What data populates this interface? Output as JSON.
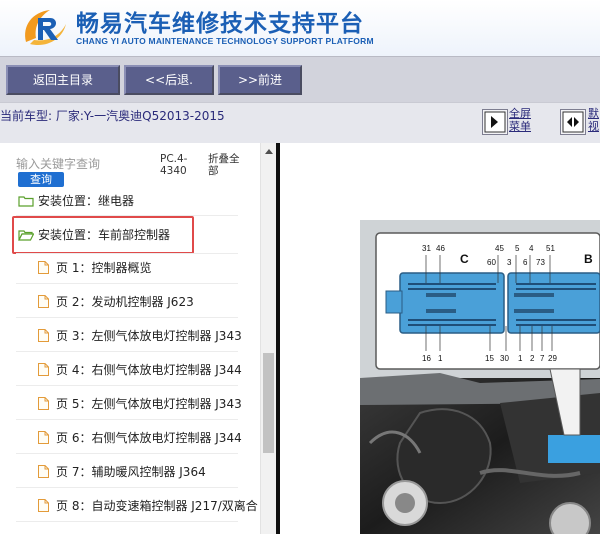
{
  "header": {
    "title": "畅易汽车维修技术支持平台",
    "subtitle": "CHANG YI AUTO MAINTENANCE TECHNOLOGY SUPPORT PLATFORM",
    "brand_color": "#1b5fb5"
  },
  "toolbar": {
    "home_label": "返回主目录",
    "back_label": "<<后退.",
    "forward_label": ">>前进"
  },
  "vehicle_bar": {
    "text": "当前车型:  厂家:Y-一汽奥迪Q52013-2015",
    "fullscreen_label_1": "全屏",
    "fullscreen_label_2": "菜单",
    "default_label_1": "默",
    "default_label_2": "视"
  },
  "search": {
    "placeholder": "输入关键字查询",
    "query_label": "查询",
    "pc_label": "PC.4-4340",
    "fold_label": "折叠全部"
  },
  "tree": {
    "folders": [
      {
        "label": "安装位置：继电器"
      },
      {
        "label": "安装位置：车前部控制器"
      }
    ],
    "pages": [
      {
        "label": "页 1：控制器概览"
      },
      {
        "label": "页 2：发动机控制器 J623"
      },
      {
        "label": "页 3：左侧气体放电灯控制器 J343"
      },
      {
        "label": "页 4：右侧气体放电灯控制器 J344"
      },
      {
        "label": "页 5：左侧气体放电灯控制器 J343"
      },
      {
        "label": "页 6：右侧气体放电灯控制器 J344"
      },
      {
        "label": "页 7：辅助暖风控制器 J364"
      },
      {
        "label": "页 8：自动变速箱控制器 J217/双离合"
      }
    ]
  },
  "diagram": {
    "label_c": "C",
    "label_b": "B",
    "top_pins_left": [
      "31",
      "46"
    ],
    "top_pins_mid": [
      "45",
      "5",
      "4",
      "51"
    ],
    "top_pins_row2": [
      "60",
      "3",
      "6",
      "73"
    ],
    "bottom_pins_left": [
      "16",
      "1"
    ],
    "bottom_pins_mid": [
      "15",
      "30",
      "1",
      "2",
      "7",
      "29"
    ]
  }
}
